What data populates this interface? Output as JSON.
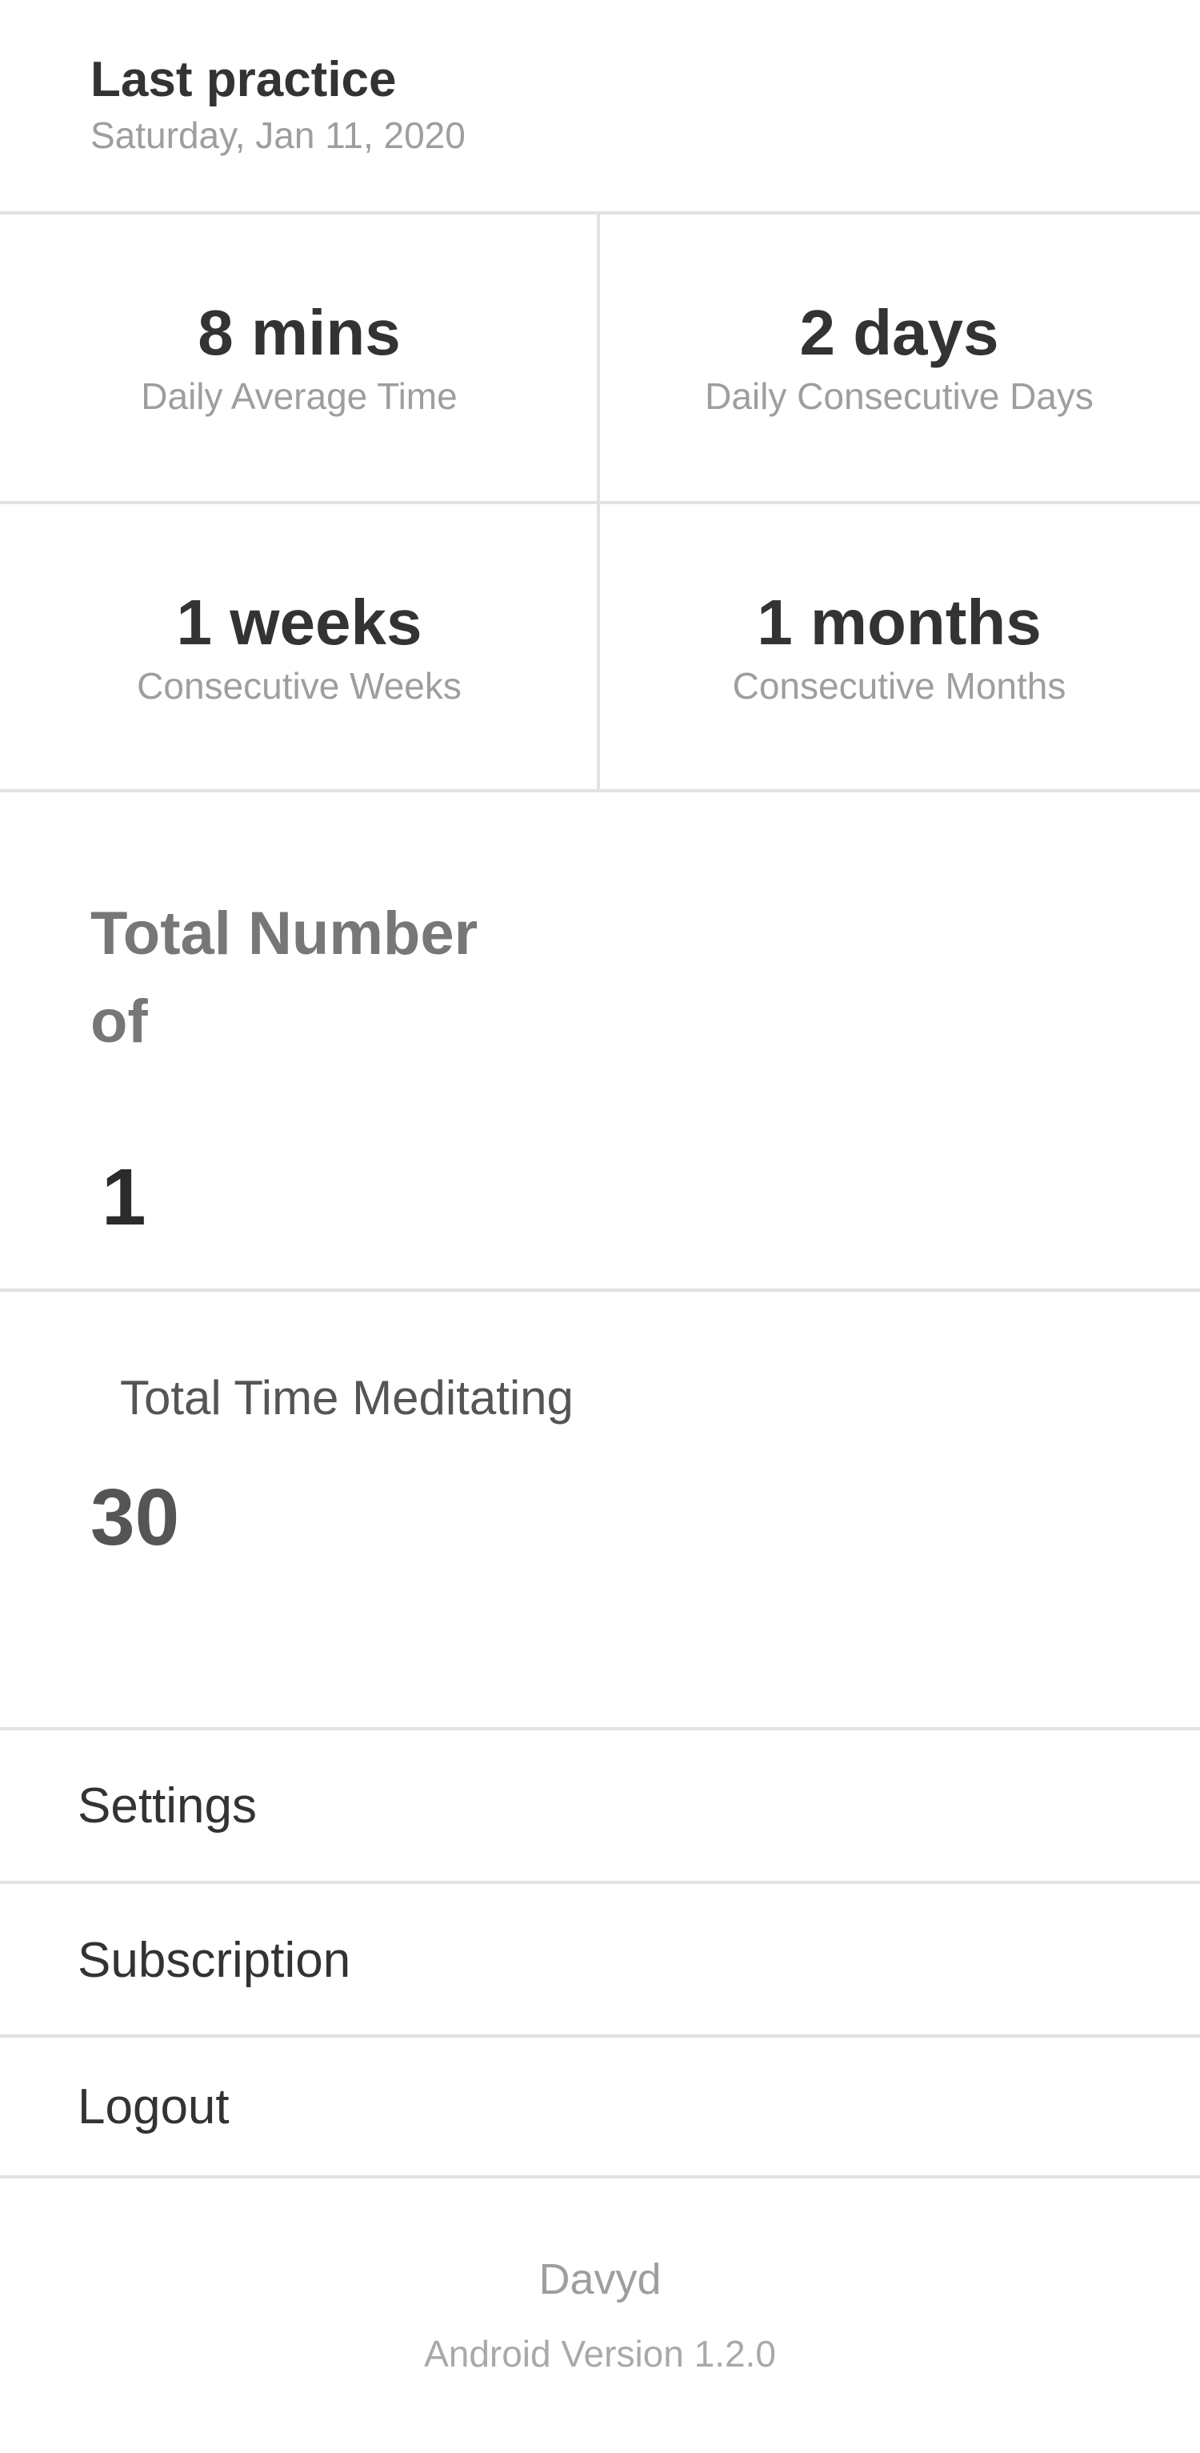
{
  "last_practice": {
    "title": "Last practice",
    "date": "Saturday, Jan 11, 2020"
  },
  "stats": [
    {
      "value": "8 mins",
      "label": "Daily Average Time"
    },
    {
      "value": "2 days",
      "label": "Daily Consecutive Days"
    },
    {
      "value": "1 weeks",
      "label": "Consecutive Weeks"
    },
    {
      "value": "1 months",
      "label": "Consecutive Months"
    }
  ],
  "total_number": {
    "title": "Total Number of",
    "value": "1"
  },
  "total_time": {
    "title": "Total Time Meditating",
    "value": "30"
  },
  "menu": {
    "settings": "Settings",
    "subscription": "Subscription",
    "logout": "Logout"
  },
  "footer": {
    "name": "Davyd",
    "version": "Android Version 1.2.0"
  }
}
